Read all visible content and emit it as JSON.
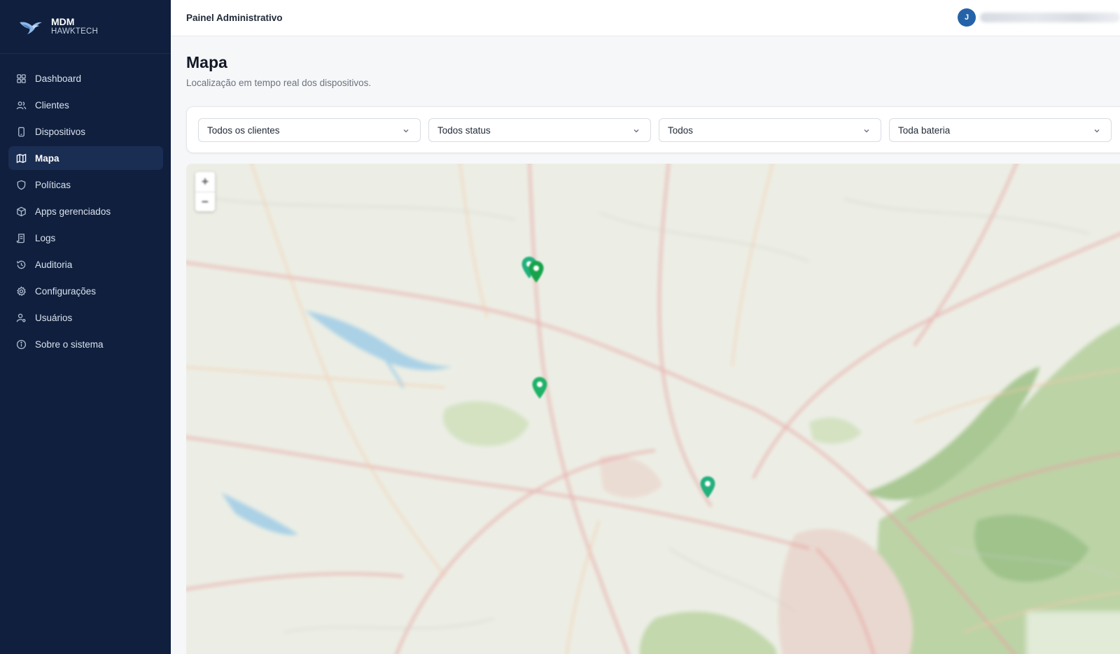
{
  "brand": {
    "title": "MDM",
    "subtitle": "HAWKTECH",
    "logo_icon": "hawk-logo-icon"
  },
  "sidebar": {
    "items": [
      {
        "label": "Dashboard",
        "icon": "dashboard-grid-icon",
        "active": false
      },
      {
        "label": "Clientes",
        "icon": "users-icon",
        "active": false
      },
      {
        "label": "Dispositivos",
        "icon": "smartphone-icon",
        "active": false
      },
      {
        "label": "Mapa",
        "icon": "map-icon",
        "active": true
      },
      {
        "label": "Políticas",
        "icon": "shield-icon",
        "active": false
      },
      {
        "label": "Apps gerenciados",
        "icon": "package-icon",
        "active": false
      },
      {
        "label": "Logs",
        "icon": "scroll-icon",
        "active": false
      },
      {
        "label": "Auditoria",
        "icon": "history-icon",
        "active": false
      },
      {
        "label": "Configurações",
        "icon": "gear-icon",
        "active": false
      },
      {
        "label": "Usuários",
        "icon": "user-cog-icon",
        "active": false
      },
      {
        "label": "Sobre o sistema",
        "icon": "info-icon",
        "active": false
      }
    ]
  },
  "header": {
    "title": "Painel Administrativo",
    "user_initial": "J"
  },
  "main": {
    "title": "Mapa",
    "subtitle": "Localização em tempo real dos dispositivos."
  },
  "filters": {
    "client": {
      "value": "Todos os clientes"
    },
    "status": {
      "value": "Todos status"
    },
    "type": {
      "value": "Todos"
    },
    "battery": {
      "value": "Toda bateria"
    }
  },
  "map": {
    "zoom_in_label": "+",
    "zoom_out_label": "−",
    "markers": [
      {
        "name": "device-marker-1",
        "status": "online"
      },
      {
        "name": "device-marker-2",
        "status": "online"
      },
      {
        "name": "device-marker-3",
        "status": "online"
      },
      {
        "name": "device-marker-4",
        "status": "online"
      }
    ]
  },
  "colors": {
    "sidebar_bg": "#0f1f3d",
    "sidebar_active": "#1a2d52",
    "avatar": "#2563a8",
    "marker_online": "#16a34a",
    "marker_alt": "#22b07d"
  }
}
